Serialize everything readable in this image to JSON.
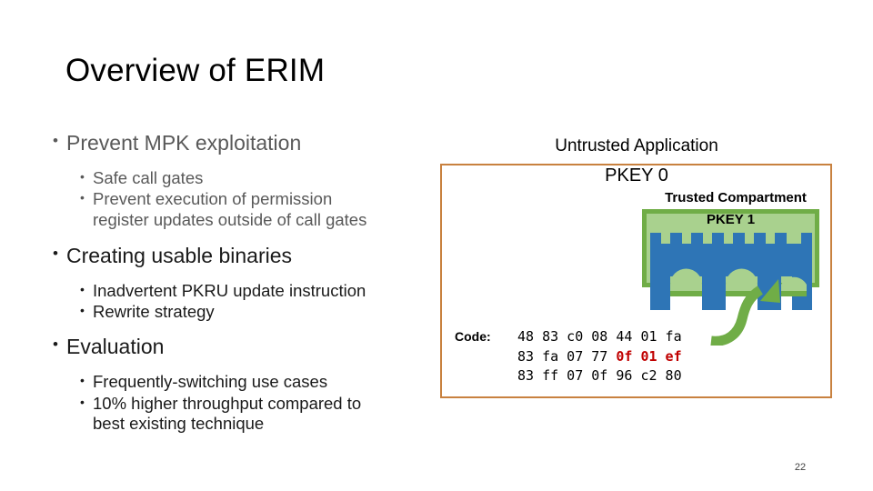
{
  "slide": {
    "title": "Overview of ERIM",
    "page_number": "22"
  },
  "outline": {
    "groups": [
      {
        "heading": "Prevent MPK exploitation",
        "tone": "gray",
        "items": [
          "Safe call gates",
          "Prevent execution of permission register updates outside of call gates"
        ]
      },
      {
        "heading": "Creating usable binaries",
        "tone": "dark",
        "items": [
          "Inadvertent PKRU update  instruction",
          "Rewrite strategy"
        ]
      },
      {
        "heading": "Evaluation",
        "tone": "dark",
        "items": [
          "Frequently-switching use cases",
          "10% higher throughput compared to best existing technique"
        ]
      }
    ],
    "bullet_glyph": "•"
  },
  "diagram": {
    "untrusted_application_label": "Untrusted Application",
    "pkey0_label": "PKEY 0",
    "trusted_compartment_label": "Trusted Compartment",
    "pkey1_label": "PKEY 1",
    "code_label": "Code:",
    "code": {
      "line1": "48 83 c0 08 44 01 fa",
      "line2_black": "83 fa 07 77 ",
      "line2_red": "0f 01 ef",
      "line3": "83 ff 07 0f 96 c2 80"
    },
    "colors": {
      "outer_border": "#C8813F",
      "compartment_fill": "#A9D18E",
      "compartment_border": "#70AD47",
      "fortress": "#2E75B6",
      "arrow": "#70AD47",
      "code_highlight": "#C00000"
    }
  }
}
